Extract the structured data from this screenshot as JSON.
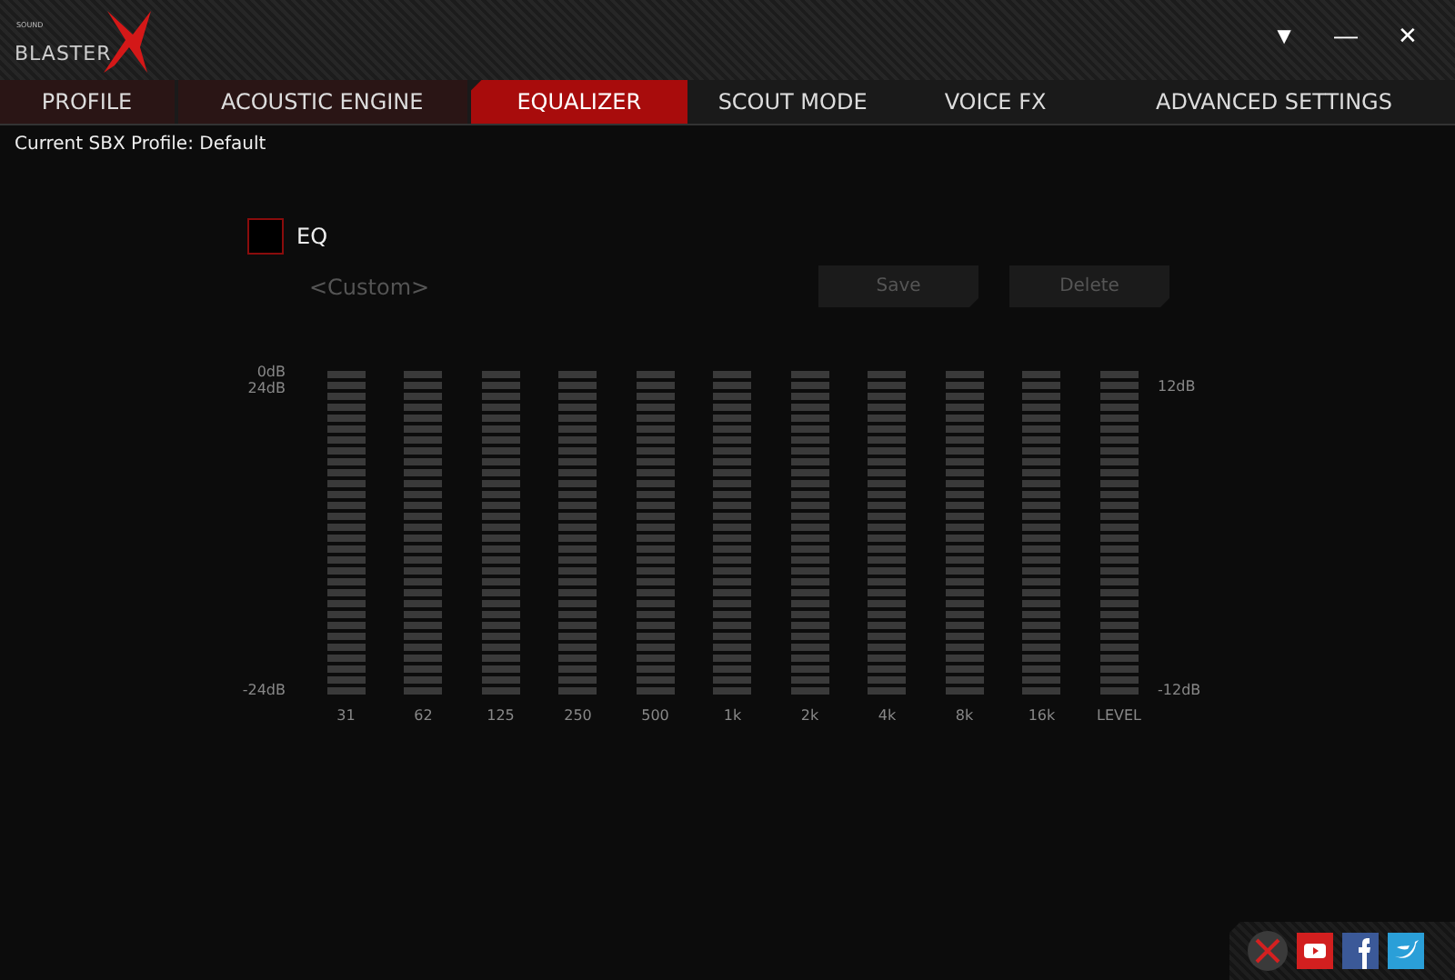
{
  "logo": {
    "small": "SOUND",
    "main": "BLASTER"
  },
  "window_controls": [
    "▼",
    "—",
    "✕"
  ],
  "tabs": [
    {
      "label": "PROFILE",
      "selected": false
    },
    {
      "label": "ACOUSTIC ENGINE",
      "selected": false
    },
    {
      "label": "EQUALIZER",
      "selected": true
    },
    {
      "label": "SCOUT MODE",
      "selected": false
    },
    {
      "label": "VOICE FX",
      "selected": false
    },
    {
      "label": "ADVANCED SETTINGS",
      "selected": false
    }
  ],
  "profile_line": "Current SBX Profile: Default",
  "eq": {
    "label": "EQ",
    "checked": false,
    "preset": "<Custom>",
    "buttons": [
      "Save",
      "Delete"
    ],
    "left_scale": {
      "top": "0dB",
      "top2": "24dB",
      "bottom": "-24dB"
    },
    "right_scale": {
      "top": "12dB",
      "bottom": "-12dB"
    },
    "bands": [
      {
        "label": "31",
        "level": 0
      },
      {
        "label": "62",
        "level": 0
      },
      {
        "label": "125",
        "level": 0
      },
      {
        "label": "250",
        "level": 0
      },
      {
        "label": "500",
        "level": 0
      },
      {
        "label": "1k",
        "level": 0
      },
      {
        "label": "2k",
        "level": 0
      },
      {
        "label": "4k",
        "level": 0
      },
      {
        "label": "8k",
        "level": 0
      },
      {
        "label": "16k",
        "level": 0
      },
      {
        "label": "LEVEL",
        "level": 0
      }
    ]
  }
}
